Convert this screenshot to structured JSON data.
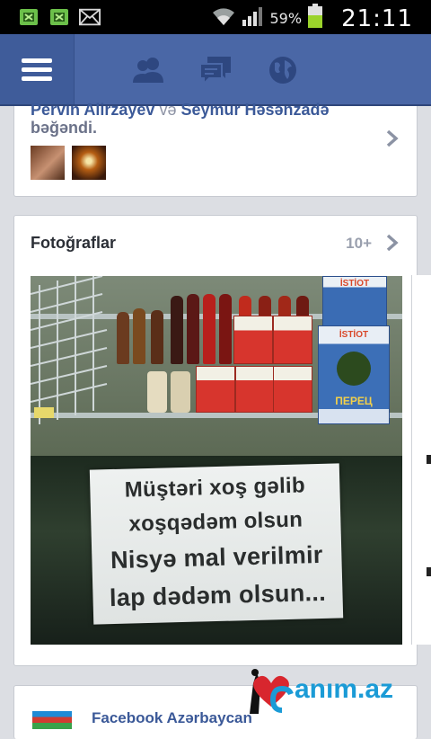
{
  "status_bar": {
    "icons_left": [
      "android-debug-icon",
      "android-debug-icon",
      "mail-icon"
    ],
    "battery_percent": "59%",
    "time": "21:11"
  },
  "top_bar": {
    "icons": [
      "menu-icon",
      "friends-icon",
      "messages-icon",
      "globe-icon"
    ]
  },
  "likes_card": {
    "name1": "Pervin Alirzayev",
    "connector": "və",
    "name2": "Seymur Həsənzadə",
    "suffix": "bəğəndi."
  },
  "photos_card": {
    "title": "Fotoğraflar",
    "count": "10+",
    "sign_lines": [
      "Müştəri xoş gəlib",
      "xoşqədəm olsun",
      "Nisyə mal verilmir",
      "lap dədəm olsun..."
    ],
    "box_label_top": "İSTİOT",
    "box_label": "İSTİOT",
    "box_sub": "ПЕРЕЦ"
  },
  "next_card": {
    "name": "Facebook Azərbaycan"
  },
  "watermark": {
    "text": "anım.az",
    "letter": "C"
  },
  "colors": {
    "fb_blue": "#4a67a6",
    "link_blue": "#3b5998"
  }
}
